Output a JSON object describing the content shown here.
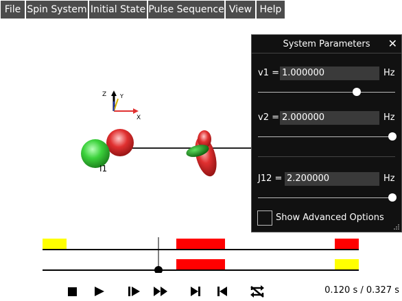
{
  "menu": {
    "items": [
      {
        "label": "File"
      },
      {
        "label": "Spin System"
      },
      {
        "label": "Initial State"
      },
      {
        "label": "Pulse Sequence"
      },
      {
        "label": "View"
      },
      {
        "label": "Help"
      }
    ]
  },
  "scene": {
    "axes": {
      "x": "X",
      "y": "Y",
      "z": "Z"
    },
    "spin_label": "I1",
    "colors": {
      "spin_green": "#3cd23c",
      "spin_red": "#e03030"
    }
  },
  "panel": {
    "title": "System Parameters",
    "close_icon": "close-icon",
    "params": [
      {
        "label": "v1 =",
        "value": "1.000000",
        "unit": "Hz",
        "slider_fraction": 0.72
      },
      {
        "label": "v2 =",
        "value": "2.000000",
        "unit": "Hz",
        "slider_fraction": 0.98
      },
      {
        "label": "J12 =",
        "value": "2.200000",
        "unit": "Hz",
        "slider_fraction": 0.98
      }
    ],
    "advanced_label": "Show Advanced Options",
    "advanced_checked": false
  },
  "timeline": {
    "colors": {
      "pulse_red": "#ff0000",
      "pulse_yellow": "#ffff00"
    }
  },
  "controls": {
    "buttons": [
      "stop-icon",
      "play-icon",
      "step-forward-icon",
      "fast-forward-icon",
      "skip-to-end-icon",
      "skip-to-start-icon",
      "loop-icon"
    ],
    "time_readout": "0.120 s / 0.327 s"
  }
}
